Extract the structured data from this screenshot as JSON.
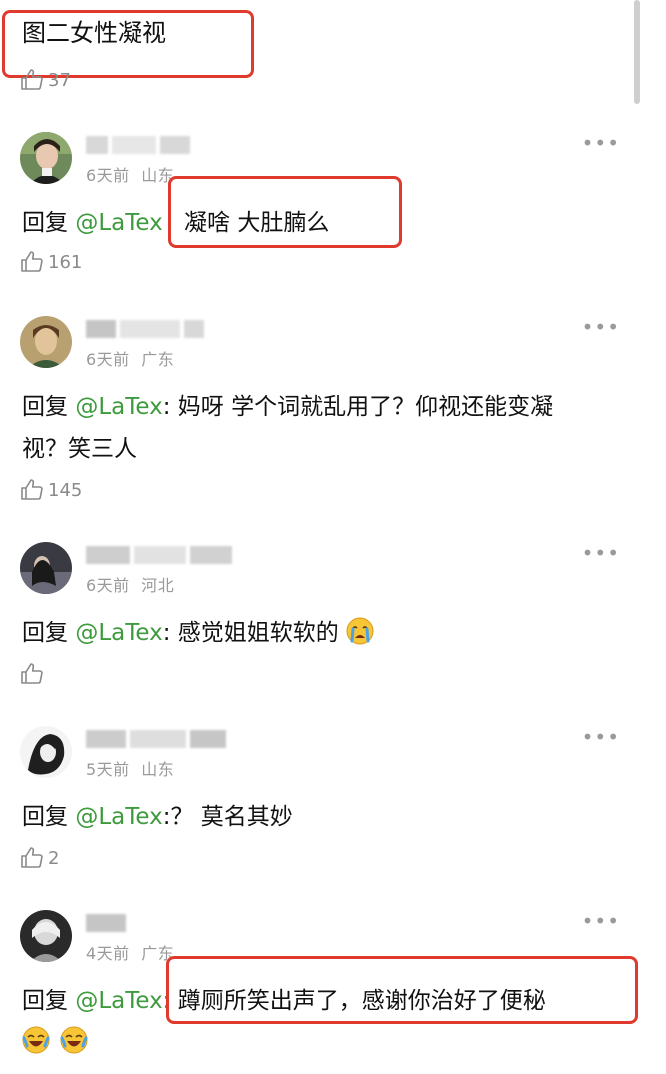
{
  "top": {
    "text": "图二女性凝视",
    "likes": "37"
  },
  "comments": [
    {
      "time": "6天前",
      "location": "山东",
      "reply_prefix": "回复",
      "mention": "@LaTex",
      "text": "凝啥 大肚腩么",
      "likes": "161"
    },
    {
      "time": "6天前",
      "location": "广东",
      "reply_prefix": "回复",
      "mention": "@LaTex",
      "text_line1": ": 妈呀 学个词就乱用了？仰视还能变凝",
      "text_line2": "视？笑三人",
      "likes": "145"
    },
    {
      "time": "6天前",
      "location": "河北",
      "reply_prefix": "回复",
      "mention": "@LaTex",
      "text": ": 感觉姐姐软软的",
      "emoji": "crying-emoji",
      "likes": ""
    },
    {
      "time": "5天前",
      "location": "山东",
      "reply_prefix": "回复",
      "mention": "@LaTex",
      "text": ":？ 莫名其妙",
      "likes": "2"
    },
    {
      "time": "4天前",
      "location": "广东",
      "reply_prefix": "回复",
      "mention": "@LaTex",
      "text": ": 蹲厕所笑出声了，感谢你治好了便秘",
      "emojis": [
        "laughing-tears-emoji",
        "laughing-tears-emoji"
      ]
    }
  ],
  "colors": {
    "mention": "#3d9b3d",
    "highlight": "#e03a2e",
    "meta": "#9a9a9a"
  }
}
